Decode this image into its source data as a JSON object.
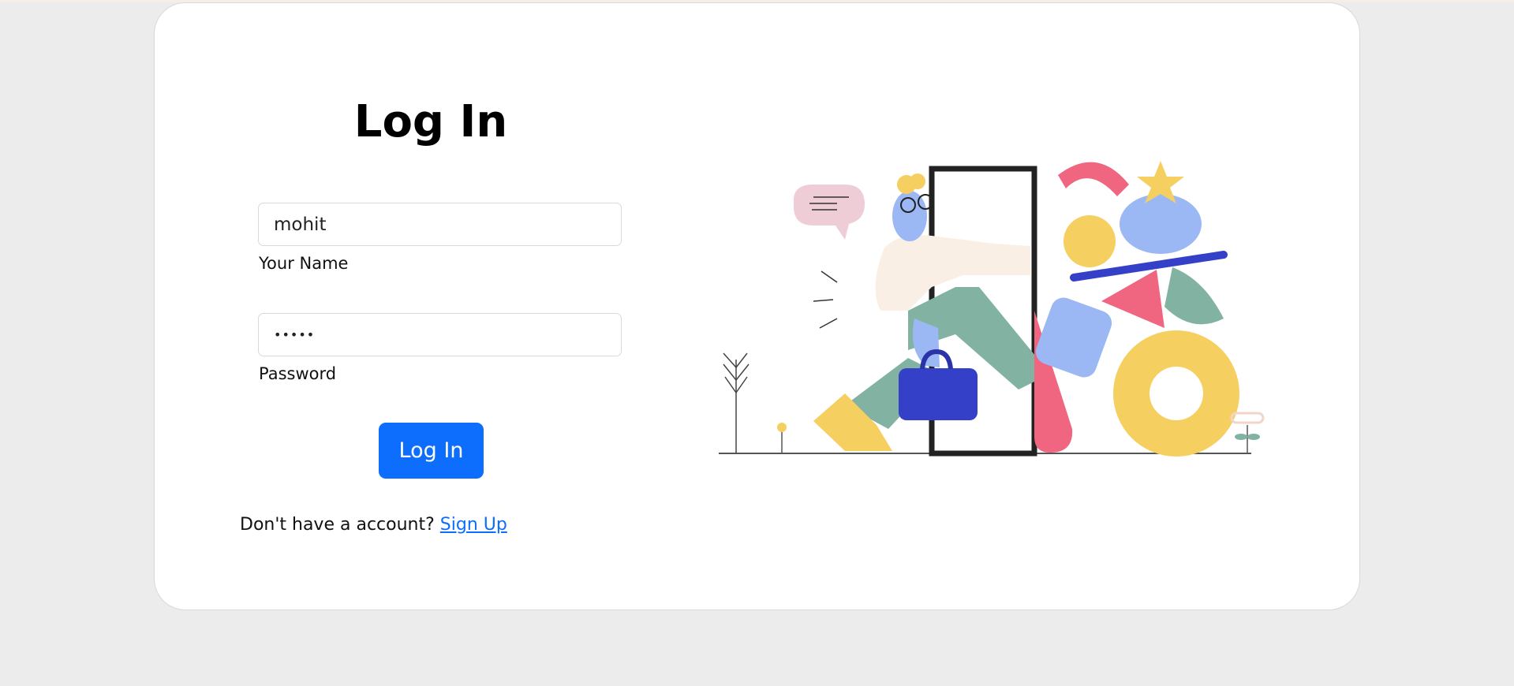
{
  "login": {
    "title": "Log In",
    "name_value": "mohit",
    "name_label": "Your Name",
    "password_value": "•••••",
    "password_label": "Password",
    "submit_label": "Log In",
    "signup_prompt": "Don't have a account?",
    "signup_link": "Sign Up"
  },
  "colors": {
    "accent": "#0d6efd",
    "page_background": "#ececec",
    "card_background": "#ffffff"
  },
  "illustration": {
    "icon": "person-walking-through-door-illustration"
  }
}
